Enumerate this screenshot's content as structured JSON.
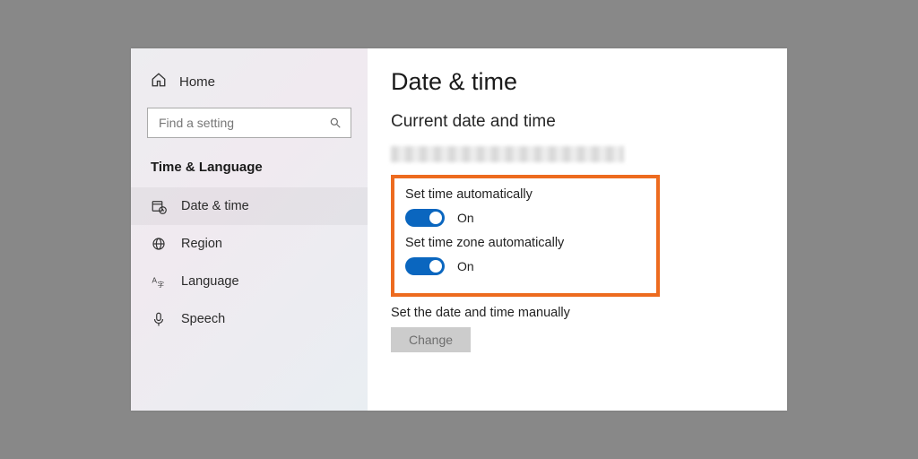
{
  "sidebar": {
    "home_label": "Home",
    "search_placeholder": "Find a setting",
    "category_title": "Time & Language",
    "items": [
      {
        "label": "Date & time"
      },
      {
        "label": "Region"
      },
      {
        "label": "Language"
      },
      {
        "label": "Speech"
      }
    ]
  },
  "main": {
    "title": "Date & time",
    "section_heading": "Current date and time",
    "set_time_auto_label": "Set time automatically",
    "set_time_auto_state": "On",
    "set_tz_auto_label": "Set time zone automatically",
    "set_tz_auto_state": "On",
    "manual_label": "Set the date and time manually",
    "change_button": "Change"
  },
  "colors": {
    "accent": "#0a66bf",
    "highlight_border": "#ed6b1f"
  }
}
